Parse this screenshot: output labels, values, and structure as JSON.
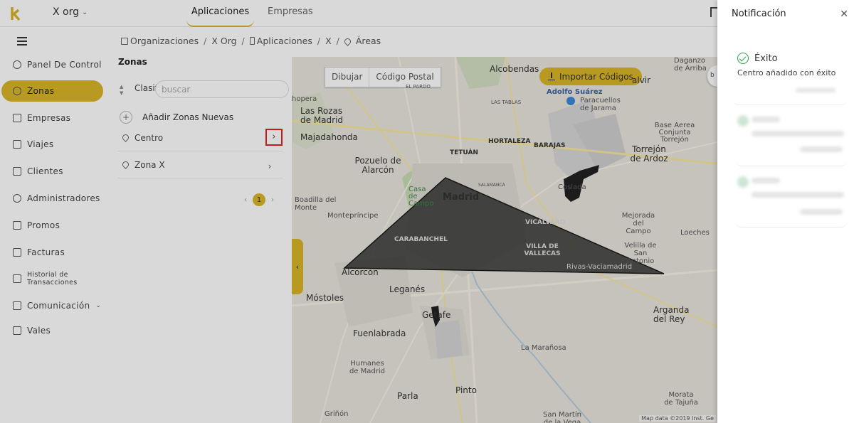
{
  "header": {
    "org_name": "X org",
    "tabs": [
      {
        "label": "Aplicaciones",
        "active": true
      },
      {
        "label": "Empresas",
        "active": false
      }
    ],
    "accent_color": "#d9b62a"
  },
  "sidebar": {
    "items": [
      {
        "label": "Panel De Control",
        "icon": "dashboard-icon"
      },
      {
        "label": "Zonas",
        "icon": "location-pin-icon",
        "active": true
      },
      {
        "label": "Empresas",
        "icon": "building-icon"
      },
      {
        "label": "Viajes",
        "icon": "car-icon"
      },
      {
        "label": "Clientes",
        "icon": "id-card-icon"
      },
      {
        "label": "Administradores",
        "icon": "users-icon"
      },
      {
        "label": "Promos",
        "icon": "gift-icon"
      },
      {
        "label": "Facturas",
        "icon": "invoice-icon"
      },
      {
        "label": "Historial de Transacciones",
        "icon": "edit-icon"
      },
      {
        "label": "Comunicación",
        "icon": "message-icon",
        "expandable": true
      },
      {
        "label": "Vales",
        "icon": "gift-icon"
      }
    ]
  },
  "breadcrumb": {
    "items": [
      "Organizaciones",
      "X Org",
      "Aplicaciones",
      "X",
      "Áreas"
    ]
  },
  "zones": {
    "title": "Zonas",
    "sort_label": "Clasif",
    "search_placeholder": "buscar",
    "add_label": "Añadir Zonas Nuevas",
    "list": [
      "Centro",
      "Zona X"
    ],
    "current_page": "1"
  },
  "map": {
    "buttons": [
      "Dibujar",
      "Código Postal"
    ],
    "import_label": "Importar Códigos",
    "credit": "Map data ©2019 Inst. Ge",
    "labels": {
      "alcobendas": "Alcobendas",
      "valvir": "alvir",
      "adolfo": "Adolfo Suárez",
      "paracuellos": "Paracuellos de Jarama",
      "daganzo": "Daganzo de Arriba",
      "hopera": "hopera",
      "las_rozas": "Las Rozas de Madrid",
      "majadahonda": "Majadahonda",
      "hortaleza": "HORTALEZA",
      "barajas": "BARAJAS",
      "tetuan": "TETUÁN",
      "pozuelo": "Pozuelo de Alarcón",
      "casa_campo": "Casa de Campo",
      "madrid": "Madrid",
      "coslada": "Coslada",
      "torrejon": "Torrejón de Ardoz",
      "base_aerea": "Base Aerea Conjunta Torrejón",
      "boadilla": "Boadilla del Monte",
      "montepricipe": "Montepríncipe",
      "carabanchel": "CARABANCHEL",
      "vicalvaro": "VICÁLVARO",
      "villa_vallecas": "VILLA DE VALLECAS",
      "mejorada": "Mejorada del Campo",
      "loeches": "Loeches",
      "velilla": "Velilla de San Antonio",
      "alcorcon": "Alcorcón",
      "rivas": "Rivas-Vaciamadrid",
      "leganes": "Leganés",
      "mostoles": "Móstoles",
      "getafe": "Getafe",
      "arganda": "Arganda del Rey",
      "fuenlabrada": "Fuenlabrada",
      "la_maranosa": "La Marañosa",
      "humanes": "Humanes de Madrid",
      "pinto": "Pinto",
      "parla": "Parla",
      "grinon": "Griñón",
      "morata": "Morata de Tajuña",
      "san_martin": "San Martín de la Vega",
      "el_pardo": "EL PARDO",
      "las_tablas": "LAS TABLAS",
      "salamanca": "SALAMANCA"
    },
    "zone_fill": "#2d2d2d"
  },
  "notification": {
    "title": "Notificación",
    "status": "Éxito",
    "message": "Centro añadido con éxito",
    "success_color": "#2e9e4c"
  }
}
